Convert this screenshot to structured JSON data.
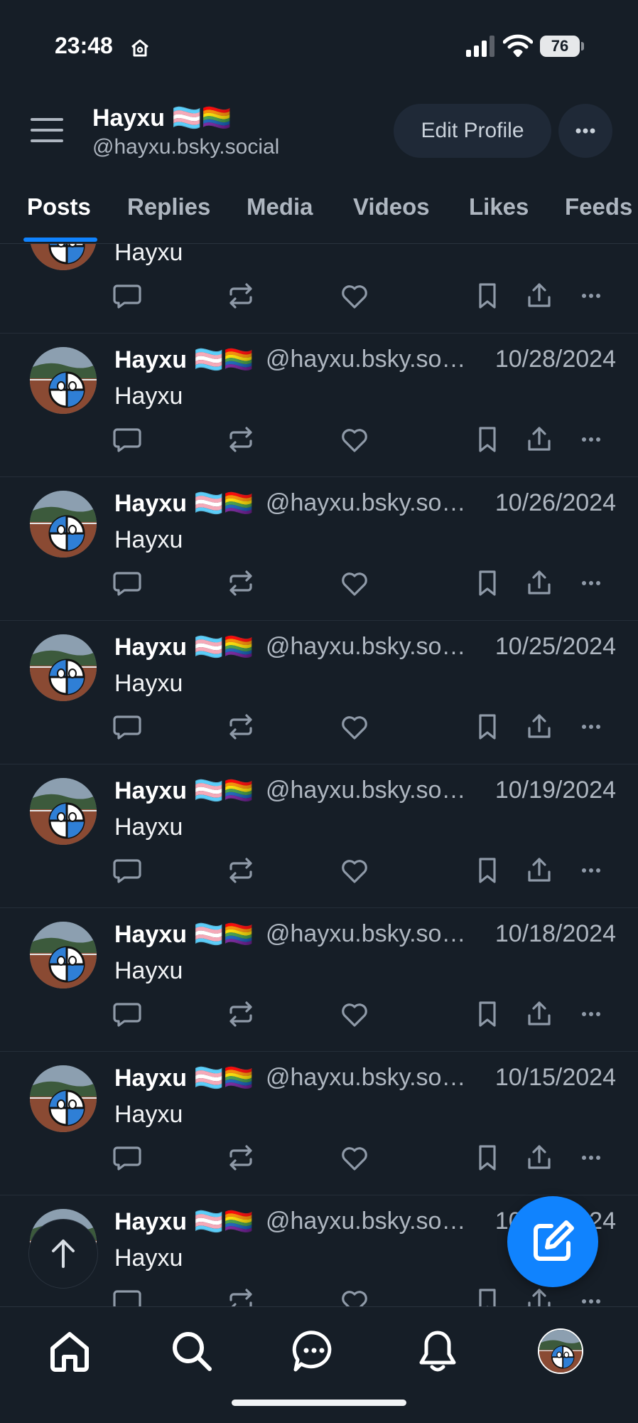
{
  "status_bar": {
    "time": "23:48",
    "battery": "76"
  },
  "header": {
    "name": "Hayxu 🏳️‍⚧️🏳️‍🌈",
    "handle": "@hayxu.bsky.social",
    "edit_profile_label": "Edit Profile"
  },
  "tabs": [
    "Posts",
    "Replies",
    "Media",
    "Videos",
    "Likes",
    "Feeds"
  ],
  "first_post": {
    "text": "Hayxu"
  },
  "posts": [
    {
      "name": "Hayxu 🏳️‍⚧️🏳️‍🌈",
      "handle": "@hayxu.bsky.social",
      "date": "10/28/2024",
      "text": "Hayxu"
    },
    {
      "name": "Hayxu 🏳️‍⚧️🏳️‍🌈",
      "handle": "@hayxu.bsky.social",
      "date": "10/26/2024",
      "text": "Hayxu"
    },
    {
      "name": "Hayxu 🏳️‍⚧️🏳️‍🌈",
      "handle": "@hayxu.bsky.social",
      "date": "10/25/2024",
      "text": "Hayxu"
    },
    {
      "name": "Hayxu 🏳️‍⚧️🏳️‍🌈",
      "handle": "@hayxu.bsky.social",
      "date": "10/19/2024",
      "text": "Hayxu"
    },
    {
      "name": "Hayxu 🏳️‍⚧️🏳️‍🌈",
      "handle": "@hayxu.bsky.social",
      "date": "10/18/2024",
      "text": "Hayxu"
    },
    {
      "name": "Hayxu 🏳️‍⚧️🏳️‍🌈",
      "handle": "@hayxu.bsky.social",
      "date": "10/15/2024",
      "text": "Hayxu"
    },
    {
      "name": "Hayxu 🏳️‍⚧️🏳️‍🌈",
      "handle": "@hayxu.bsky.social",
      "date": "10/14/2024",
      "text": "Hayxu"
    }
  ],
  "icons": {
    "post_actions": [
      "reply-icon",
      "repost-icon",
      "like-icon",
      "bookmark-icon",
      "share-icon",
      "more-icon"
    ],
    "bottom_nav": [
      "home-icon",
      "search-icon",
      "chat-icon",
      "notifications-icon",
      "profile-avatar"
    ]
  },
  "colors": {
    "background": "#161e27",
    "accent": "#1083fe",
    "muted_text": "#aeb6c0",
    "icon": "#8f9aa8"
  }
}
